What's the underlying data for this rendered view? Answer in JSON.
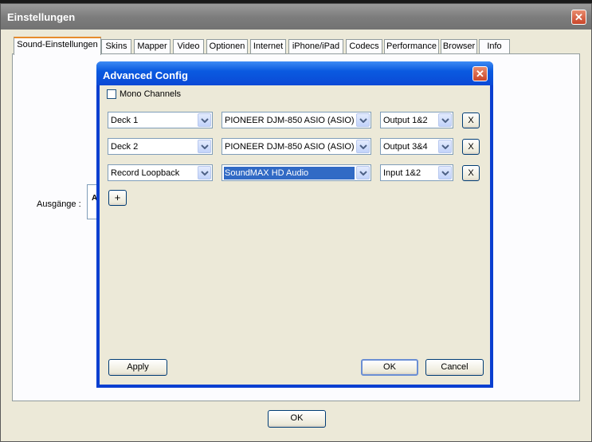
{
  "window": {
    "title": "Einstellungen",
    "close": "✕"
  },
  "tabs": [
    {
      "label": "Sound-Einstellungen"
    },
    {
      "label": "Skins"
    },
    {
      "label": "Mapper"
    },
    {
      "label": "Video"
    },
    {
      "label": "Optionen"
    },
    {
      "label": "Internet"
    },
    {
      "label": "iPhone/iPad"
    },
    {
      "label": "Codecs"
    },
    {
      "label": "Performance"
    },
    {
      "label": "Browser"
    },
    {
      "label": "Info"
    }
  ],
  "panel": {
    "ausgaenge_label": "Ausgänge :",
    "ausgaenge_box_text": "A"
  },
  "outer_ok": "OK",
  "dialog": {
    "title": "Advanced Config",
    "close": "✕",
    "mono_label": "Mono Channels",
    "rows": [
      {
        "source": "Deck 1",
        "device": "PIONEER DJM-850 ASIO (ASIO)",
        "channel": "Output 1&2",
        "remove": "X"
      },
      {
        "source": "Deck 2",
        "device": "PIONEER DJM-850 ASIO (ASIO)",
        "channel": "Output 3&4",
        "remove": "X"
      },
      {
        "source": "Record Loopback",
        "device": "SoundMAX HD Audio",
        "channel": "Input 1&2",
        "remove": "X"
      }
    ],
    "add": "+",
    "apply": "Apply",
    "ok": "OK",
    "cancel": "Cancel"
  },
  "colors": {
    "title_blue": "#0a5ae0",
    "selection": "#316ac5",
    "tab_accent": "#e68b2c"
  }
}
